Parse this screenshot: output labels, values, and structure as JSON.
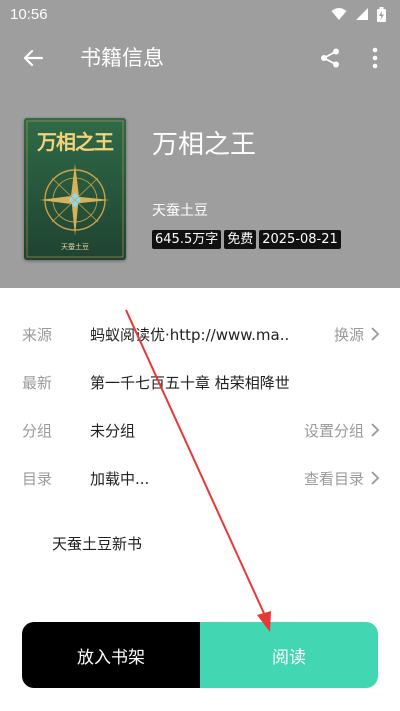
{
  "status_bar": {
    "time": "10:56"
  },
  "toolbar": {
    "title": "书籍信息"
  },
  "book": {
    "title": "万相之王",
    "author": "天蚕土豆",
    "cover_title": "万相之王",
    "cover_author": "天蚕土豆",
    "tags": [
      "645.5万字",
      "免费",
      "2025-08-21"
    ]
  },
  "info_rows": [
    {
      "label": "来源",
      "value": "蚂蚁阅读优·http://www.ma...",
      "action": "换源"
    },
    {
      "label": "最新",
      "value": "第一千七百五十章 枯荣相降世",
      "action": ""
    },
    {
      "label": "分组",
      "value": "未分组",
      "action": "设置分组"
    },
    {
      "label": "目录",
      "value": "加载中...",
      "action": "查看目录"
    }
  ],
  "intro": "天蚕土豆新书",
  "actions": {
    "shelf": "放入书架",
    "read": "阅读"
  },
  "colors": {
    "header_bg": "#9e9e9e",
    "accent": "#43d6b3",
    "shelf_button": "#000000",
    "arrow": "#e53935"
  },
  "icons": [
    "back-arrow-icon",
    "share-icon",
    "more-vert-icon",
    "wifi-icon",
    "signal-icon",
    "battery-icon",
    "chevron-right-icon"
  ]
}
